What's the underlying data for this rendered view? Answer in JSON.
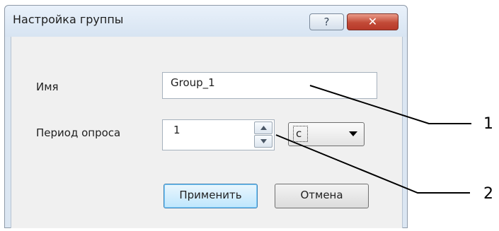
{
  "dialog": {
    "title": "Настройка группы",
    "help_label": "?",
    "close_label": "✕"
  },
  "form": {
    "name_label": "Имя",
    "name_value": "Group_1",
    "period_label": "Период опроса",
    "period_value": "1",
    "unit_value": "с"
  },
  "buttons": {
    "apply_label": "Применить",
    "cancel_label": "Отмена"
  },
  "callouts": [
    "1",
    "2"
  ],
  "colors": {
    "accent": "#3c7fb1",
    "close": "#c24a37"
  }
}
